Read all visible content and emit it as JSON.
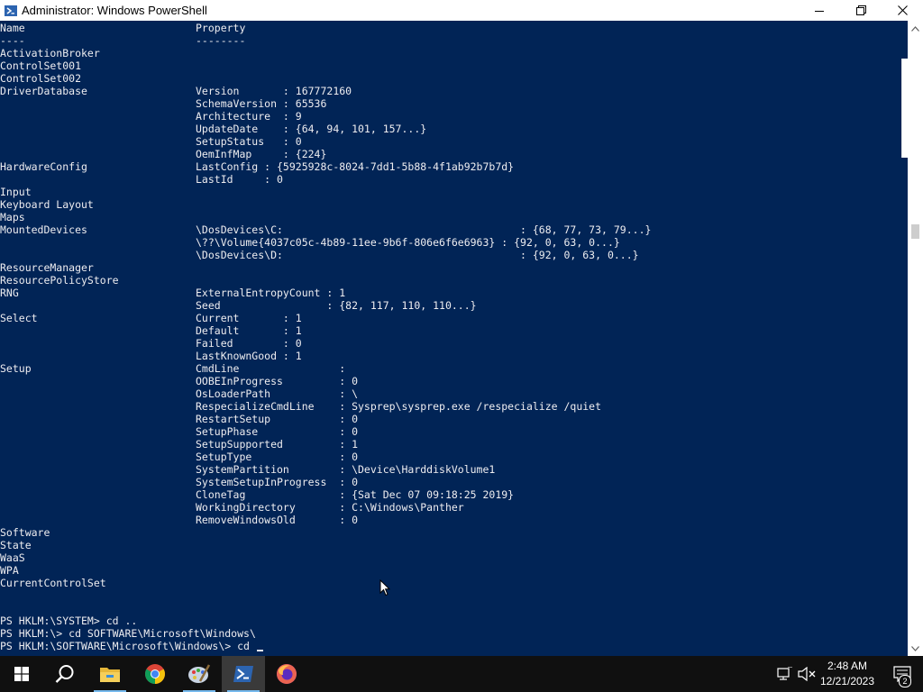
{
  "window": {
    "title": "Administrator: Windows PowerShell",
    "icon": "powershell-icon",
    "buttons": [
      "minimize-icon",
      "maximize-icon",
      "close-icon"
    ]
  },
  "console": {
    "lines": [
      {
        "c1": "Name",
        "c2": "Property"
      },
      {
        "c1": "----",
        "c2": "--------"
      },
      {
        "c1": "ActivationBroker",
        "c2": ""
      },
      {
        "c1": "ControlSet001",
        "c2": ""
      },
      {
        "c1": "ControlSet002",
        "c2": ""
      },
      {
        "c1": "DriverDatabase",
        "c2": "Version       : 167772160"
      },
      {
        "c1": "",
        "c2": "SchemaVersion : 65536"
      },
      {
        "c1": "",
        "c2": "Architecture  : 9"
      },
      {
        "c1": "",
        "c2": "UpdateDate    : {64, 94, 101, 157...}"
      },
      {
        "c1": "",
        "c2": "SetupStatus   : 0"
      },
      {
        "c1": "",
        "c2": "OemInfMap     : {224}"
      },
      {
        "c1": "HardwareConfig",
        "c2": "LastConfig : {5925928c-8024-7dd1-5b88-4f1ab92b7b7d}"
      },
      {
        "c1": "",
        "c2": "LastId     : 0"
      },
      {
        "c1": "Input",
        "c2": ""
      },
      {
        "c1": "Keyboard Layout",
        "c2": ""
      },
      {
        "c1": "Maps",
        "c2": ""
      },
      {
        "c1": "MountedDevices",
        "c2": "\\DosDevices\\C:                                      : {68, 77, 73, 79...}"
      },
      {
        "c1": "",
        "c2": "\\??\\Volume{4037c05c-4b89-11ee-9b6f-806e6f6e6963} : {92, 0, 63, 0...}"
      },
      {
        "c1": "",
        "c2": "\\DosDevices\\D:                                      : {92, 0, 63, 0...}"
      },
      {
        "c1": "ResourceManager",
        "c2": ""
      },
      {
        "c1": "ResourcePolicyStore",
        "c2": ""
      },
      {
        "c1": "RNG",
        "c2": "ExternalEntropyCount : 1"
      },
      {
        "c1": "",
        "c2": "Seed                 : {82, 117, 110, 110...}"
      },
      {
        "c1": "Select",
        "c2": "Current       : 1"
      },
      {
        "c1": "",
        "c2": "Default       : 1"
      },
      {
        "c1": "",
        "c2": "Failed        : 0"
      },
      {
        "c1": "",
        "c2": "LastKnownGood : 1"
      },
      {
        "c1": "Setup",
        "c2": "CmdLine                :"
      },
      {
        "c1": "",
        "c2": "OOBEInProgress         : 0"
      },
      {
        "c1": "",
        "c2": "OsLoaderPath           : \\"
      },
      {
        "c1": "",
        "c2": "RespecializeCmdLine    : Sysprep\\sysprep.exe /respecialize /quiet"
      },
      {
        "c1": "",
        "c2": "RestartSetup           : 0"
      },
      {
        "c1": "",
        "c2": "SetupPhase             : 0"
      },
      {
        "c1": "",
        "c2": "SetupSupported         : 1"
      },
      {
        "c1": "",
        "c2": "SetupType              : 0"
      },
      {
        "c1": "",
        "c2": "SystemPartition        : \\Device\\HarddiskVolume1"
      },
      {
        "c1": "",
        "c2": "SystemSetupInProgress  : 0"
      },
      {
        "c1": "",
        "c2": "CloneTag               : {Sat Dec 07 09:18:25 2019}"
      },
      {
        "c1": "",
        "c2": "WorkingDirectory       : C:\\Windows\\Panther"
      },
      {
        "c1": "",
        "c2": "RemoveWindowsOld       : 0"
      },
      {
        "c1": "Software",
        "c2": ""
      },
      {
        "c1": "State",
        "c2": ""
      },
      {
        "c1": "WaaS",
        "c2": ""
      },
      {
        "c1": "WPA",
        "c2": ""
      },
      {
        "c1": "CurrentControlSet",
        "c2": ""
      },
      {
        "c1": "",
        "c2": ""
      },
      {
        "c1": "",
        "c2": ""
      },
      {
        "c1": "PS HKLM:\\SYSTEM> cd ..",
        "c2": ""
      },
      {
        "c1": "PS HKLM:\\> cd SOFTWARE\\Microsoft\\Windows\\",
        "c2": ""
      },
      {
        "c1": "PS HKLM:\\SOFTWARE\\Microsoft\\Windows\\> cd ",
        "c2": ""
      }
    ]
  },
  "taskbar": {
    "apps": [
      {
        "name": "start-button",
        "icon": "windows-logo-icon",
        "active": false
      },
      {
        "name": "search-button",
        "icon": "search-icon",
        "active": false
      },
      {
        "name": "taskbar-file-explorer",
        "icon": "folder-icon",
        "active": false
      },
      {
        "name": "taskbar-chrome",
        "icon": "chrome-icon",
        "active": false
      },
      {
        "name": "taskbar-paint",
        "icon": "paint-icon",
        "active": false
      },
      {
        "name": "taskbar-powershell",
        "icon": "powershell-icon",
        "active": true
      },
      {
        "name": "taskbar-firefox",
        "icon": "firefox-icon",
        "active": false
      }
    ],
    "tray": {
      "network_icon": "network-icon",
      "volume_icon": "volume-muted-icon",
      "time": "2:48 AM",
      "date": "12/21/2023",
      "notification_count": "2"
    }
  },
  "colors": {
    "console_bg": "#012456",
    "console_fg": "#eeedf0",
    "taskbar_bg": "#101010",
    "active_underline": "#76b9ed"
  }
}
